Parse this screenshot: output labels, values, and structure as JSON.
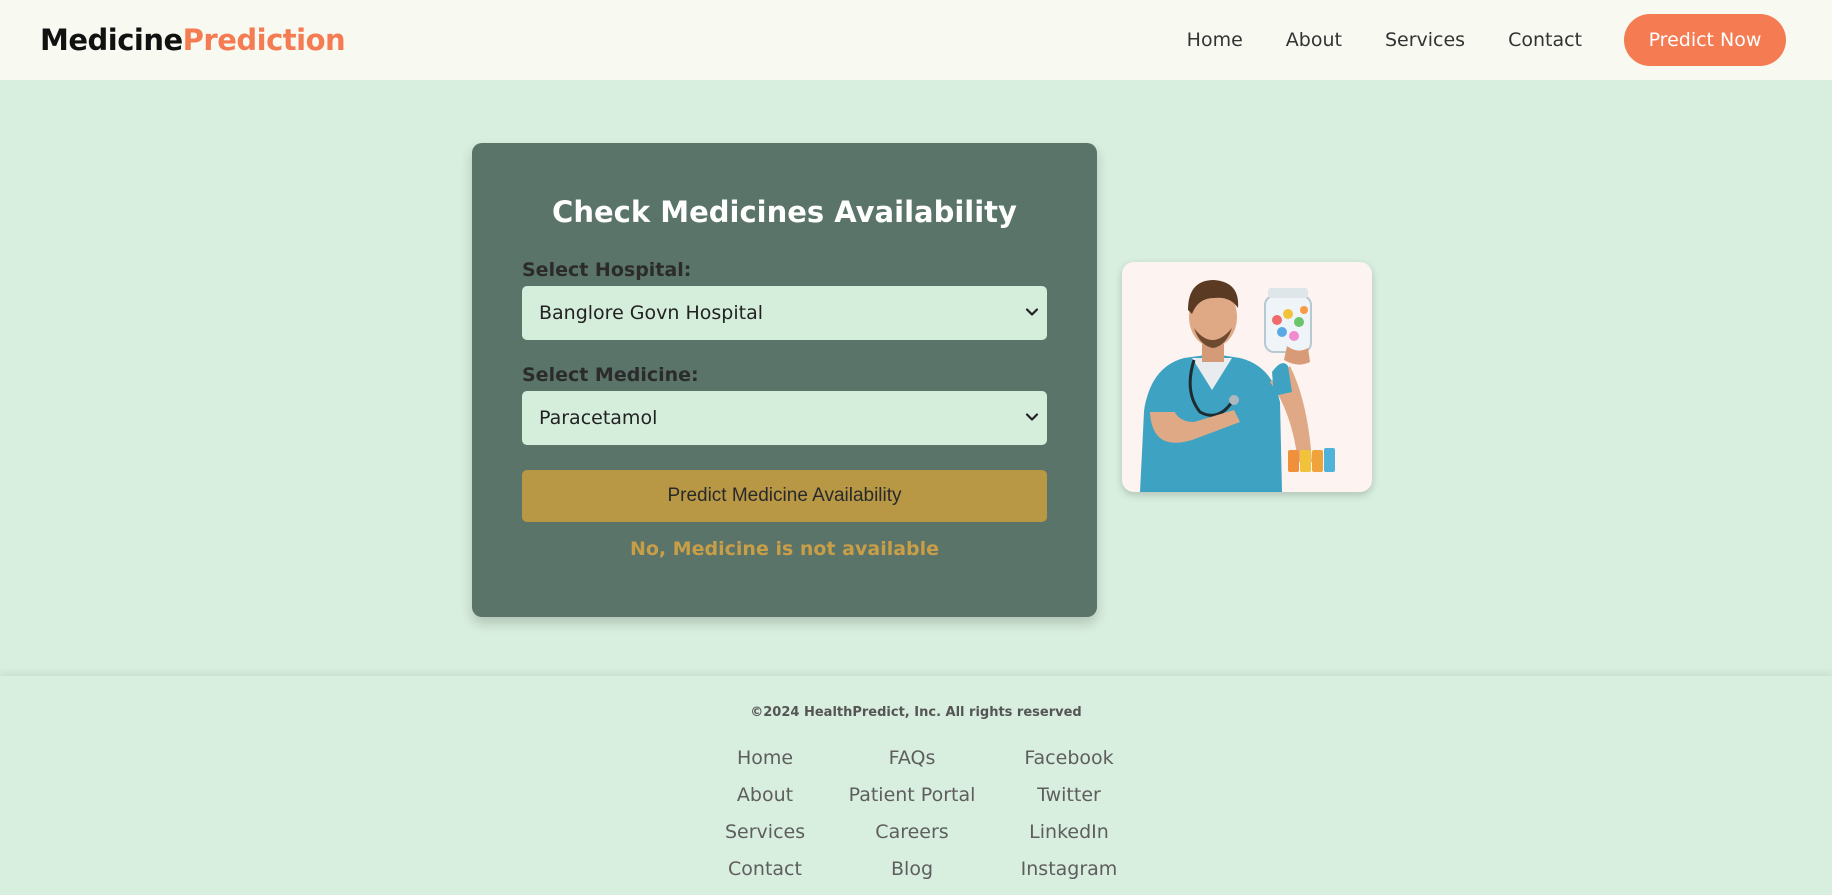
{
  "header": {
    "logo_part1": "Medicine",
    "logo_part2": "Prediction",
    "nav": [
      "Home",
      "About",
      "Services",
      "Contact"
    ],
    "cta_label": "Predict Now"
  },
  "form": {
    "title": "Check Medicines Availability",
    "hospital_label": "Select Hospital:",
    "hospital_value": "Banglore Govn Hospital",
    "medicine_label": "Select Medicine:",
    "medicine_value": "Paracetamol",
    "button_label": "Predict Medicine Availability",
    "result": "No, Medicine is not available"
  },
  "image": {
    "description_icon": "doctor-holding-pill-jar-illustration"
  },
  "footer": {
    "copyright": "©2024 HealthPredict, Inc. All rights reserved",
    "col1": [
      "Home",
      "About",
      "Services",
      "Contact"
    ],
    "col2": [
      "FAQs",
      "Patient Portal",
      "Careers",
      "Blog"
    ],
    "col3": [
      "Facebook",
      "Twitter",
      "LinkedIn",
      "Instagram"
    ]
  },
  "colors": {
    "accent": "#f47b52",
    "card": "#5a7469",
    "button": "#b89845",
    "page_bg": "#d8eede"
  }
}
